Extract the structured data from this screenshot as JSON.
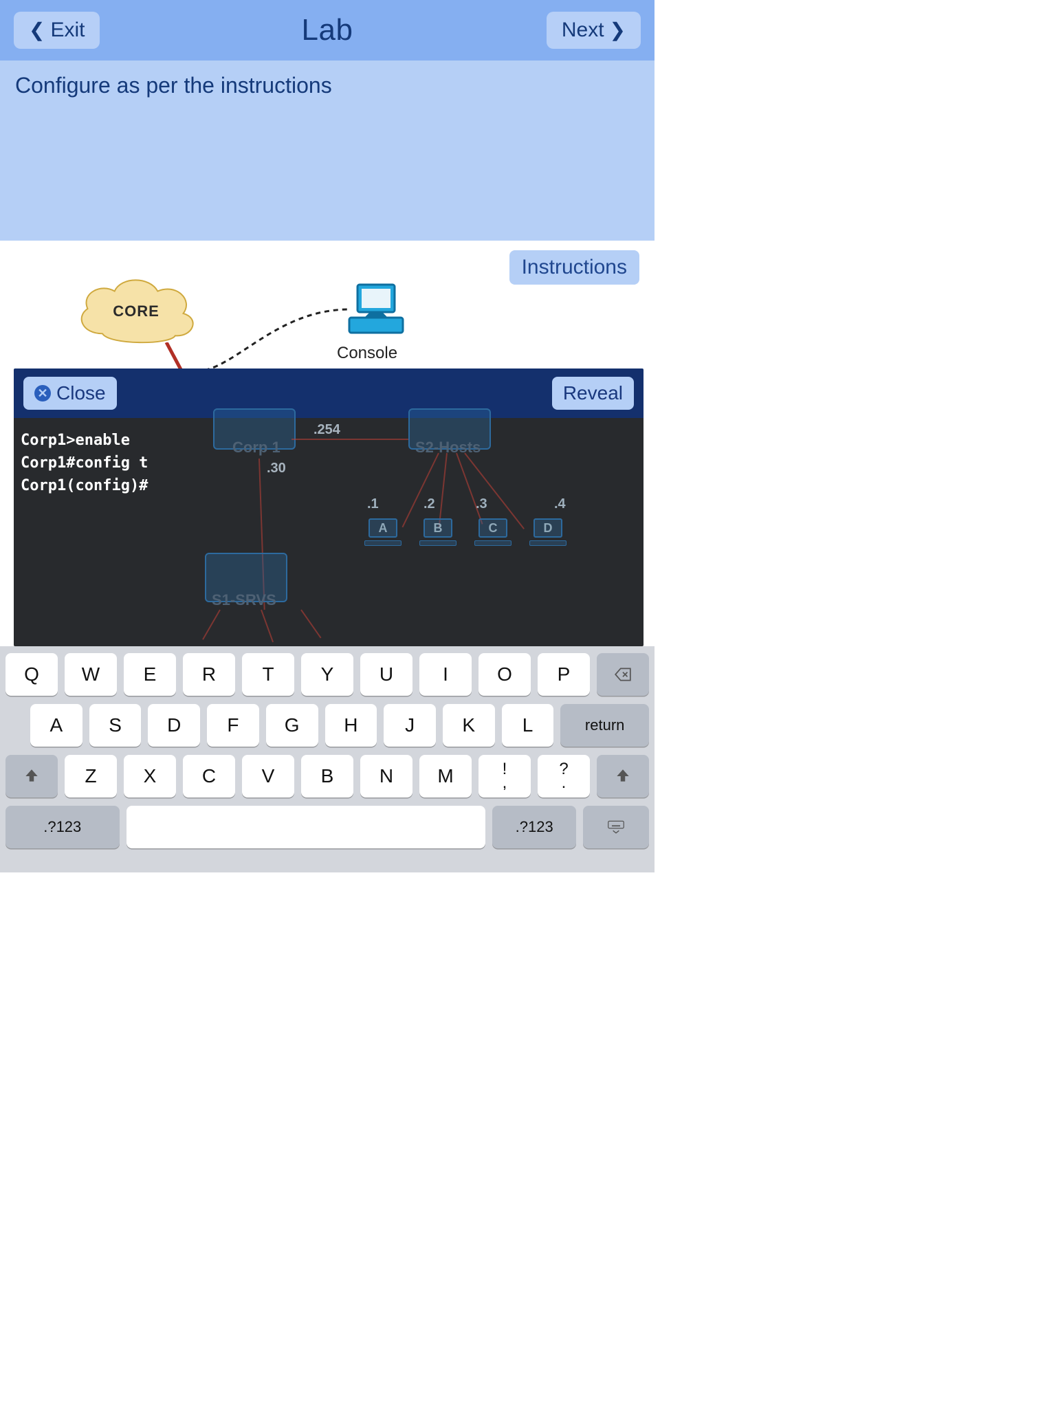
{
  "nav": {
    "exit_label": "Exit",
    "title": "Lab",
    "next_label": "Next"
  },
  "instruction_text": "Configure as per the instructions",
  "topology": {
    "core_label": "CORE",
    "console_label": "Console",
    "instructions_button": "Instructions"
  },
  "console_panel": {
    "close_label": "Close",
    "reveal_label": "Reveal",
    "lines": [
      "Corp1>enable",
      "Corp1#config t",
      "Corp1(config)#"
    ]
  },
  "ghost_topology": {
    "ip_254": ".254",
    "corp1": "Corp 1",
    "ip_30": ".30",
    "s2_hosts": "S2-Hosts",
    "host_ips": [
      ".1",
      ".2",
      ".3",
      ".4"
    ],
    "host_labels": [
      "A",
      "B",
      "C",
      "D"
    ],
    "s1_srvs": "S1-SRVS"
  },
  "keyboard": {
    "row1": [
      "Q",
      "W",
      "E",
      "R",
      "T",
      "Y",
      "U",
      "I",
      "O",
      "P"
    ],
    "row2": [
      "A",
      "S",
      "D",
      "F",
      "G",
      "H",
      "J",
      "K",
      "L"
    ],
    "row3": [
      "Z",
      "X",
      "C",
      "V",
      "B",
      "N",
      "M"
    ],
    "punct1_top": "!",
    "punct1_bot": ",",
    "punct2_top": "?",
    "punct2_bot": ".",
    "return_label": "return",
    "mode_label": ".?123"
  }
}
